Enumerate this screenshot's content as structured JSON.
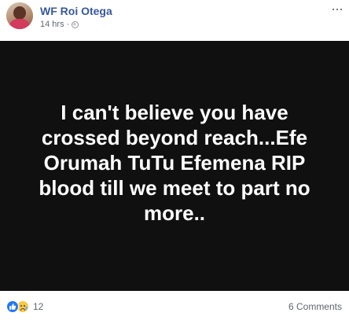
{
  "post": {
    "author": "WF Roi Otega",
    "timestamp": "14 hrs",
    "separator": "·",
    "menu_label": "···",
    "banner_text": "I can't believe you have crossed beyond reach...Efe Orumah TuTu Efemena RIP blood till we meet to part no more..",
    "banner_background": "#101010",
    "banner_text_color": "#ffffff",
    "author_color": "#385898"
  },
  "footer": {
    "reaction_icons": [
      "like-icon",
      "sad-icon"
    ],
    "reaction_count": "12",
    "comments_label": "6 Comments"
  }
}
